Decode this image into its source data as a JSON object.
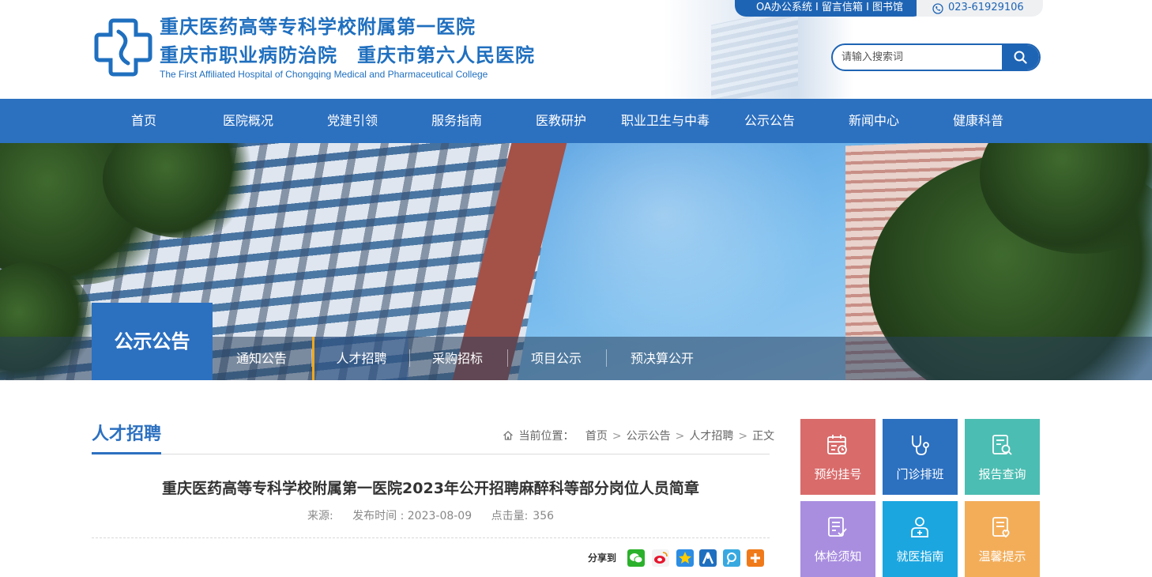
{
  "header": {
    "title_line1": "重庆医药高等专科学校附属第一医院",
    "title_line2": "重庆市职业病防治院　重庆市第六人民医院",
    "title_en": "The First Affiliated Hospital of Chongqing Medical and Pharmaceutical College",
    "top_links": "OA办公系统 I 留言信箱 I 图书馆",
    "phone": "023-61929106",
    "search_placeholder": "请输入搜索词"
  },
  "nav": [
    "首页",
    "医院概况",
    "党建引领",
    "服务指南",
    "医教研护",
    "职业卫生与中毒",
    "公示公告",
    "新闻中心",
    "健康科普"
  ],
  "banner": {
    "section_title": "公示公告",
    "subnav": [
      "通知公告",
      "人才招聘",
      "采购招标",
      "项目公示",
      "预决算公开"
    ],
    "active_subnav": "人才招聘"
  },
  "content": {
    "column_title": "人才招聘",
    "breadcrumb_label": "当前位置：",
    "breadcrumb": [
      "首页",
      "公示公告",
      "人才招聘",
      "正文"
    ],
    "article_title": "重庆医药高等专科学校附属第一医院2023年公开招聘麻醉科等部分岗位人员简章",
    "source_label": "来源:",
    "date_label": "发布时间 : 2023-08-09",
    "hits_label": "点击量:",
    "hits": "356",
    "share_label": "分享到"
  },
  "tiles": [
    {
      "label": "预约挂号",
      "icon": "calendar-icon",
      "color": "#d96b6b"
    },
    {
      "label": "门诊排班",
      "icon": "stethoscope-icon",
      "color": "#2c70c0"
    },
    {
      "label": "报告查询",
      "icon": "report-search-icon",
      "color": "#4cbdb2"
    },
    {
      "label": "体检须知",
      "icon": "checkup-form-icon",
      "color": "#a98ee0"
    },
    {
      "label": "就医指南",
      "icon": "doctor-icon",
      "color": "#1ba6e0"
    },
    {
      "label": "温馨提示",
      "icon": "notice-icon",
      "color": "#f3ad59"
    }
  ]
}
